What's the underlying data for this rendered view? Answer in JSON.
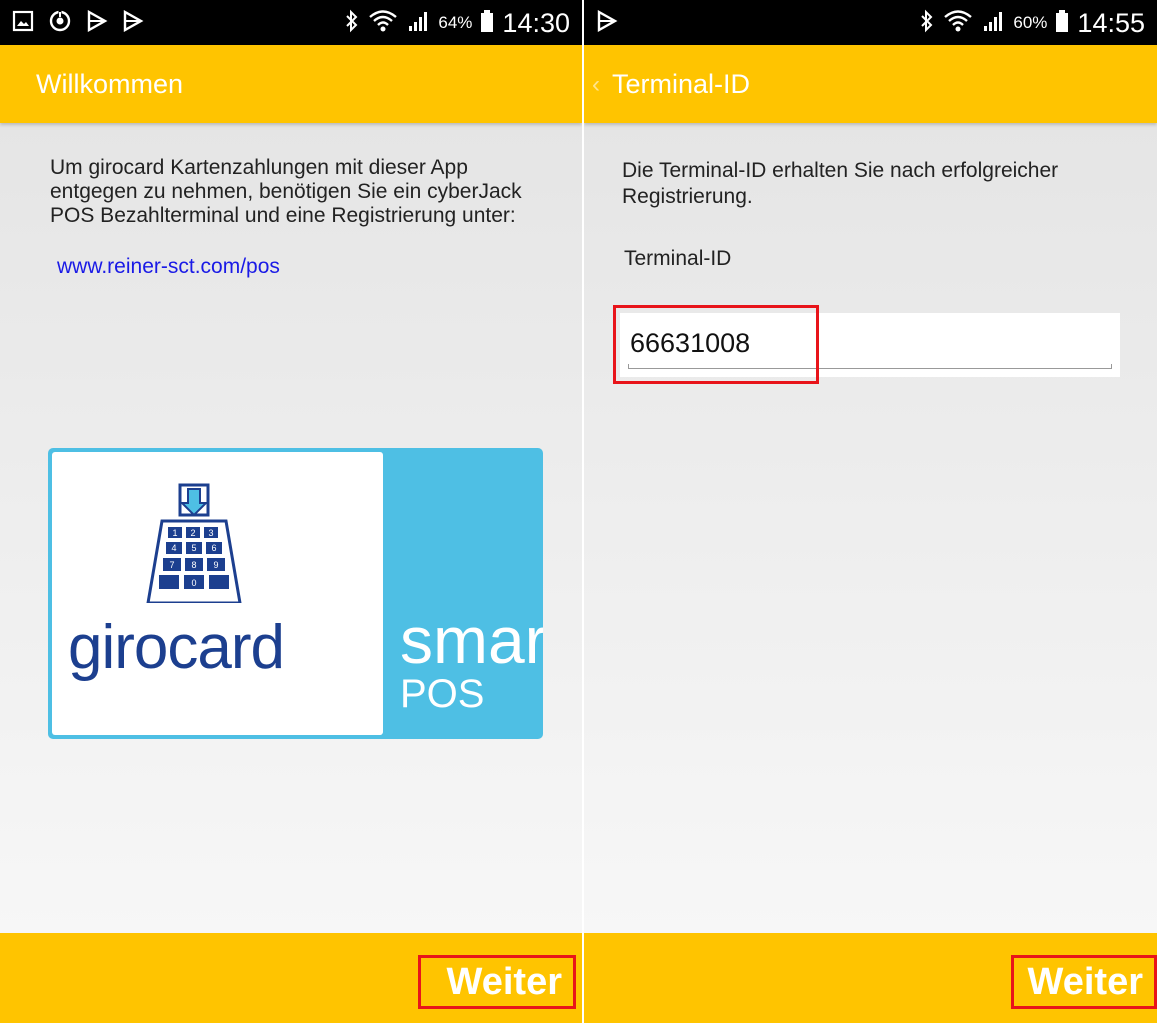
{
  "left_screen": {
    "status": {
      "battery_pct": "64%",
      "time": "14:30",
      "icons": [
        "image-icon",
        "sync-icon",
        "play-store-icon",
        "play-store-icon",
        "bluetooth-icon",
        "wifi-icon",
        "signal-icon",
        "battery-icon"
      ]
    },
    "title": "Willkommen",
    "intro_text": "Um girocard Kartenzahlungen mit dieser App entgegen zu nehmen, benötigen Sie ein cyberJack POS Bezahlterminal und eine Registrierung unter:",
    "link": "www.reiner-sct.com/pos",
    "logo": {
      "brand": "girocard",
      "product": "smart",
      "subproduct": "POS",
      "keypad_digits": [
        "1",
        "2",
        "3",
        "4",
        "5",
        "6",
        "7",
        "8",
        "9",
        "0"
      ]
    },
    "next_label": "Weiter"
  },
  "right_screen": {
    "status": {
      "battery_pct": "60%",
      "time": "14:55",
      "icons": [
        "play-store-icon",
        "bluetooth-icon",
        "wifi-icon",
        "signal-icon",
        "battery-icon"
      ]
    },
    "back_icon": "chevron-left-icon",
    "title": "Terminal-ID",
    "description": "Die Terminal-ID erhalten Sie nach erfolgreicher Registrierung.",
    "field_label": "Terminal-ID",
    "field_value": "66631008",
    "next_label": "Weiter"
  },
  "colors": {
    "accent": "#FFC400",
    "highlight": "#E8141A",
    "link": "#1A1AE6",
    "logo_blue": "#4EBFE4",
    "logo_navy": "#1C3F8F"
  }
}
